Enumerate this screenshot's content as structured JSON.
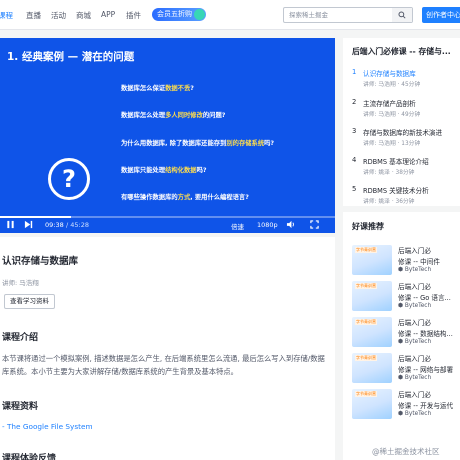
{
  "nav": {
    "items": [
      "课程",
      "直播",
      "活动",
      "商城",
      "APP",
      "插件"
    ],
    "promo_label": "会员五折购",
    "search_placeholder": "探索稀土掘金",
    "creator_button": "创作者中心"
  },
  "player": {
    "title": "1. 经典案例 — 潜在的问题",
    "questions": [
      {
        "before": "数据库怎么保证",
        "highlight": "数据不丢",
        "after": "?"
      },
      {
        "before": "数据库怎么处理",
        "highlight": "多人同时修改",
        "after": "的问题?"
      },
      {
        "before": "为什么用数据库, 除了数据库还能存到",
        "highlight": "别的存储系统",
        "after": "吗?"
      },
      {
        "before": "数据库只能处理",
        "highlight": "结构化数据",
        "after": "吗?"
      },
      {
        "before": "有哪些操作数据库的",
        "highlight": "方式",
        "after": ", 要用什么编程语言?"
      }
    ],
    "time_current": "09:38",
    "time_total": "/ 45:28",
    "progress": 0.212,
    "speed_label": "倍速",
    "quality_label": "1080p",
    "icons": [
      "play-icon",
      "next-icon",
      "volume-icon",
      "fullscreen-icon"
    ]
  },
  "lesson": {
    "title": "认识存储与数据库",
    "meta": "讲师: 马浩翔",
    "notes_button": "查看学习资料",
    "intro_heading": "课程介绍",
    "intro_text": "本节课将通过一个模拟案例, 描述数据是怎么产生, 在后端系统里怎么流通, 最后怎么写入到存储/数据库系统。本小节主要为大家讲解存储/数据库系统的产生背景及基本特点。",
    "resources_heading": "课程资料",
    "resource_link": "- The Google File System",
    "next_heading": "课程体验反馈"
  },
  "outline": {
    "title": "后端入门必修课 -- 存储与...",
    "items": [
      {
        "num": "1",
        "title": "认识存储与数据库",
        "sub": "讲师: 马浩翔 · 45分钟",
        "active": true
      },
      {
        "num": "2",
        "title": "主流存储产品剖析",
        "sub": "讲师: 马浩翔 · 49分钟",
        "active": false
      },
      {
        "num": "3",
        "title": "存储与数据库的新技术演进",
        "sub": "讲师: 马浩翔 · 13分钟",
        "active": false
      },
      {
        "num": "4",
        "title": "RDBMS 基本理论介绍",
        "sub": "讲师: 姚泽 · 38分钟",
        "active": false
      },
      {
        "num": "5",
        "title": "RDBMS 关键技术分析",
        "sub": "讲师: 姚泽 · 36分钟",
        "active": false
      }
    ]
  },
  "recommend": {
    "title": "好课推荐",
    "thumb_tag": "字节青训营",
    "items": [
      {
        "line1": "后端入门必",
        "line2": "修课 -- 中间件",
        "author": "ByteTech"
      },
      {
        "line1": "后端入门必",
        "line2": "修课 -- Go 语言...",
        "author": "ByteTech"
      },
      {
        "line1": "后端入门必",
        "line2": "修课 -- 数据结构...",
        "author": "ByteTech"
      },
      {
        "line1": "后端入门必",
        "line2": "修课 -- 网络与部署",
        "author": "ByteTech"
      },
      {
        "line1": "后端入门必",
        "line2": "修课 -- 开发与运代",
        "author": "ByteTech"
      }
    ]
  },
  "watermark": "@稀土掘金技术社区",
  "colors": {
    "accent": "#1e80ff",
    "player_bg": "#0f54e8",
    "highlight": "#ffde4d"
  }
}
